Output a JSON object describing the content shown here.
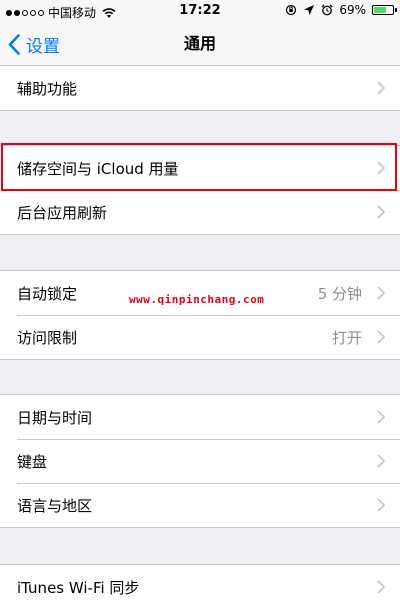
{
  "status_bar": {
    "carrier": "中国移动",
    "time": "17:22",
    "battery_percent": "69%",
    "battery_level": 0.69,
    "signal": {
      "filled": 2,
      "total": 5
    },
    "icons": [
      "wifi-icon",
      "location-arrow-icon",
      "alarm-clock-icon",
      "orientation-lock-icon"
    ]
  },
  "nav": {
    "back_label": "设置",
    "title": "通用"
  },
  "groups": [
    {
      "rows": [
        {
          "label": "辅助功能",
          "value": ""
        }
      ]
    },
    {
      "rows": [
        {
          "label": "储存空间与 iCloud 用量",
          "value": ""
        },
        {
          "label": "后台应用刷新",
          "value": ""
        }
      ]
    },
    {
      "rows": [
        {
          "label": "自动锁定",
          "value": "5 分钟"
        },
        {
          "label": "访问限制",
          "value": "打开"
        }
      ]
    },
    {
      "rows": [
        {
          "label": "日期与时间",
          "value": ""
        },
        {
          "label": "键盘",
          "value": ""
        },
        {
          "label": "语言与地区",
          "value": ""
        }
      ]
    },
    {
      "rows": [
        {
          "label": "iTunes Wi-Fi 同步",
          "value": ""
        }
      ]
    }
  ],
  "watermark": "www.qinpinchang.com",
  "colors": {
    "accent": "#007aff",
    "highlight": "#e60012",
    "battery": "#4cd964",
    "background": "#efeff4"
  }
}
